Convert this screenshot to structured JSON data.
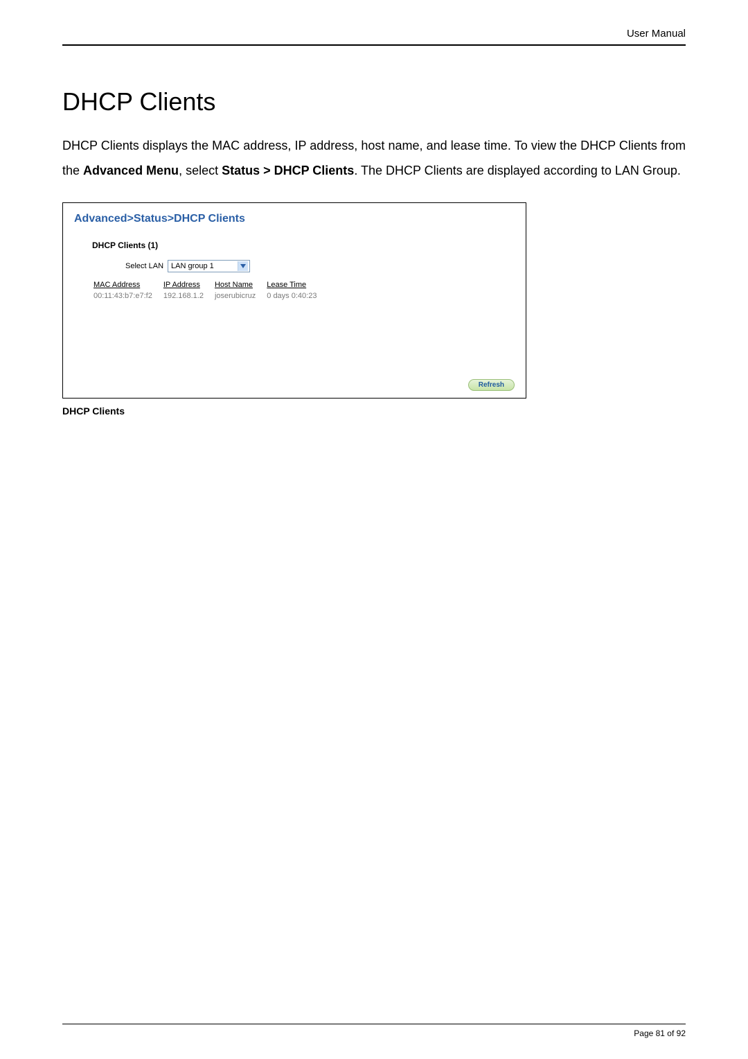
{
  "header": {
    "label": "User Manual"
  },
  "heading": "DHCP Clients",
  "paragraph": {
    "p1": "DHCP Clients displays the MAC address, IP address, host name, and lease time. To view the DHCP Clients from the ",
    "b1": "Advanced Menu",
    "p2": ", select ",
    "b2": "Status > DHCP Clients",
    "p3": ". The DHCP Clients are displayed according to LAN Group."
  },
  "screenshot": {
    "breadcrumb": "Advanced>Status>DHCP Clients",
    "panel_title": "DHCP Clients (1)",
    "select_label": "Select LAN",
    "select_value": "LAN group 1",
    "columns": {
      "mac": "MAC Address",
      "ip": "IP Address",
      "host": "Host Name",
      "lease": "Lease Time"
    },
    "rows": [
      {
        "mac": "00:11:43:b7:e7:f2",
        "ip": "192.168.1.2",
        "host": "joserubicruz",
        "lease": "0 days 0:40:23"
      }
    ],
    "refresh": "Refresh"
  },
  "caption": "DHCP Clients",
  "footer": {
    "text": "Page 81 of 92"
  }
}
